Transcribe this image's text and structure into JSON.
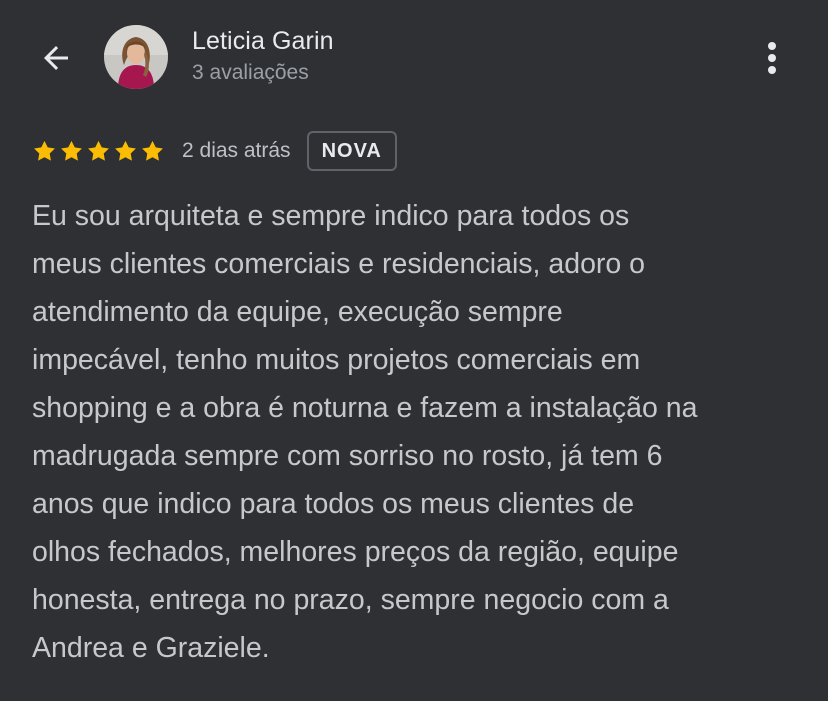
{
  "header": {
    "back_icon": "arrow-back-icon",
    "user_name": "Leticia Garin",
    "user_reviews": "3 avaliações",
    "more_icon": "more-vert-icon"
  },
  "review": {
    "rating": 5,
    "max_rating": 5,
    "star_color": "#fbbc04",
    "date": "2 dias atrás",
    "badge": "NOVA",
    "text": "Eu sou arquiteta e sempre indico para todos os\nmeus clientes comerciais e residenciais, adoro o\natendimento da equipe, execução sempre\nimpecável, tenho muitos projetos comerciais em\nshopping e a obra é noturna e fazem a instalação na\nmadrugada sempre com sorriso no rosto, já tem 6\nanos que indico para todos os meus clientes de\nolhos fechados, melhores preços da região, equipe\nhonesta, entrega no prazo, sempre negocio com a\nAndrea e Graziele."
  },
  "colors": {
    "background": "#2f3033",
    "primary_text": "#e8eaed",
    "secondary_text": "#9aa0a6"
  }
}
